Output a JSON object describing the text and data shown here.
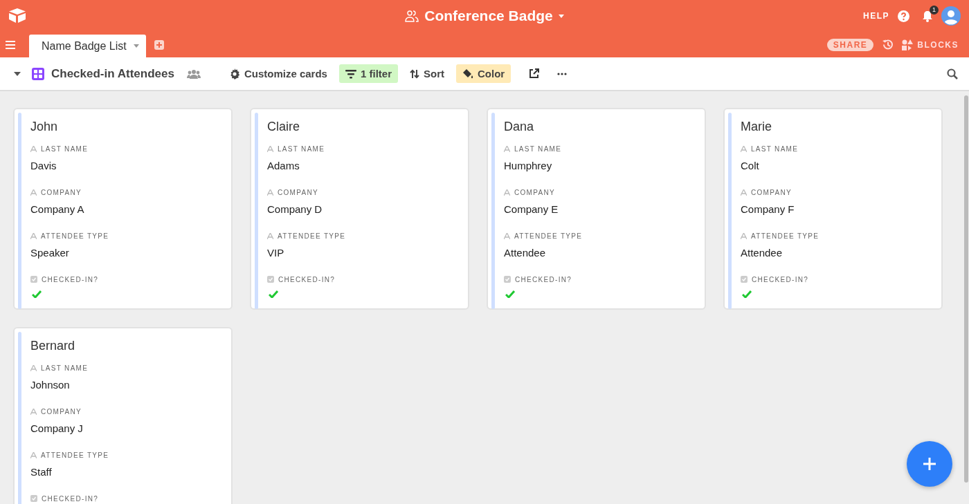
{
  "app_bar": {
    "base_title": "Conference Badge",
    "help": "HELP",
    "notification_count": "1"
  },
  "tabs": [
    {
      "label": "Name Badge List",
      "selected": true
    }
  ],
  "actions": [
    {
      "kind": "share",
      "label": "SHARE"
    },
    {
      "kind": "blocks",
      "label": "BLOCKS"
    }
  ],
  "view": {
    "name": "Checked-in Attendees"
  },
  "toolbar": [
    {
      "kind": "customize",
      "label": "Customize cards",
      "active": false
    },
    {
      "kind": "filter",
      "label": "1 filter",
      "active": true
    },
    {
      "kind": "sort",
      "label": "Sort",
      "active": false
    },
    {
      "kind": "color",
      "label": "Color",
      "active": true
    }
  ],
  "cards": [
    {
      "title": "John",
      "fields": [
        {
          "kind": "text",
          "label": "LAST NAME",
          "value": "Davis"
        },
        {
          "kind": "text",
          "label": "COMPANY",
          "value": "Company A"
        },
        {
          "kind": "text",
          "label": "ATTENDEE TYPE",
          "value": "Speaker"
        },
        {
          "kind": "checkbox",
          "label": "CHECKED-IN?",
          "checked": true
        }
      ]
    },
    {
      "title": "Claire",
      "fields": [
        {
          "kind": "text",
          "label": "LAST NAME",
          "value": "Adams"
        },
        {
          "kind": "text",
          "label": "COMPANY",
          "value": "Company D"
        },
        {
          "kind": "text",
          "label": "ATTENDEE TYPE",
          "value": "VIP"
        },
        {
          "kind": "checkbox",
          "label": "CHECKED-IN?",
          "checked": true
        }
      ]
    },
    {
      "title": "Dana",
      "fields": [
        {
          "kind": "text",
          "label": "LAST NAME",
          "value": "Humphrey"
        },
        {
          "kind": "text",
          "label": "COMPANY",
          "value": "Company E"
        },
        {
          "kind": "text",
          "label": "ATTENDEE TYPE",
          "value": "Attendee"
        },
        {
          "kind": "checkbox",
          "label": "CHECKED-IN?",
          "checked": true
        }
      ]
    },
    {
      "title": "Marie",
      "fields": [
        {
          "kind": "text",
          "label": "LAST NAME",
          "value": "Colt"
        },
        {
          "kind": "text",
          "label": "COMPANY",
          "value": "Company F"
        },
        {
          "kind": "text",
          "label": "ATTENDEE TYPE",
          "value": "Attendee"
        },
        {
          "kind": "checkbox",
          "label": "CHECKED-IN?",
          "checked": true
        }
      ]
    },
    {
      "title": "Bernard",
      "fields": [
        {
          "kind": "text",
          "label": "LAST NAME",
          "value": "Johnson"
        },
        {
          "kind": "text",
          "label": "COMPANY",
          "value": "Company J"
        },
        {
          "kind": "text",
          "label": "ATTENDEE TYPE",
          "value": "Staff"
        },
        {
          "kind": "checkbox",
          "label": "CHECKED-IN?"
        }
      ]
    }
  ]
}
